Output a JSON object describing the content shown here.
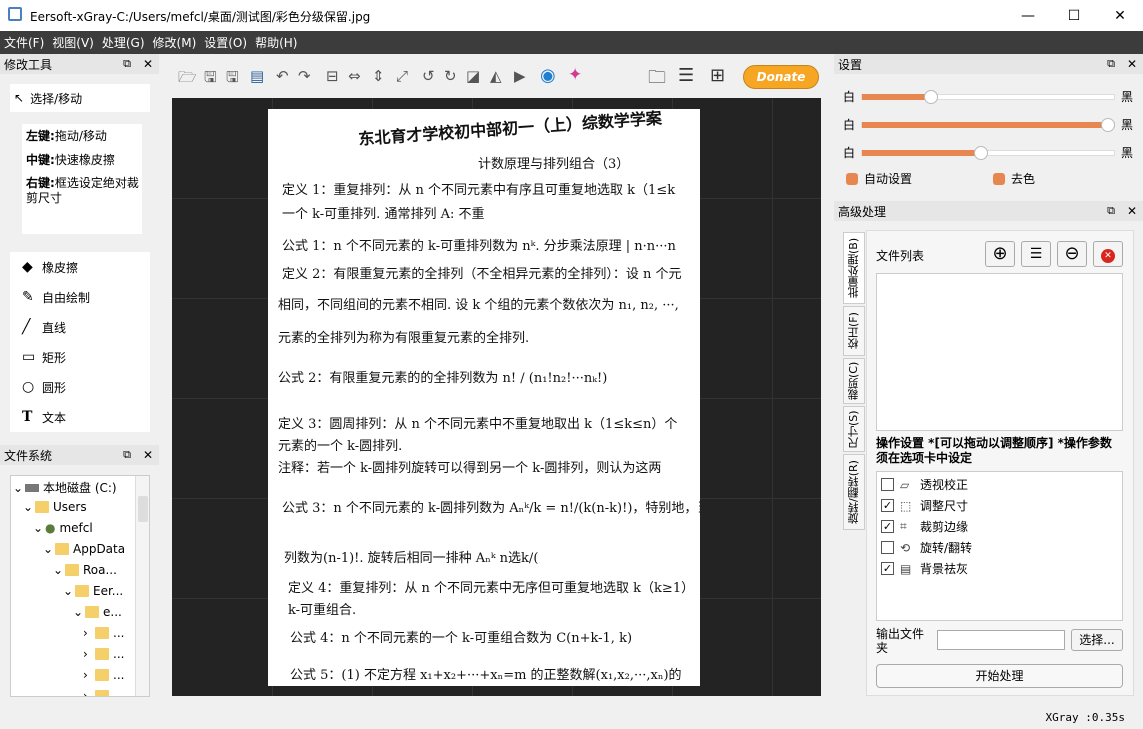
{
  "window": {
    "title": "Eersoft-xGray-C:/Users/mefcl/桌面/测试图/彩色分级保留.jpg",
    "minimize": "—",
    "maximize": "☐",
    "close": "✕"
  },
  "menu": [
    "文件(F)",
    "视图(V)",
    "处理(G)",
    "修改(M)",
    "设置(O)",
    "帮助(H)"
  ],
  "toolbar": {
    "donate": "Donate"
  },
  "tools_panel": {
    "title": "修改工具",
    "select": "选择/移动",
    "left_key": "左键:",
    "left_desc": "拖动/移动",
    "mid_key": "中键:",
    "mid_desc": "快速橡皮擦",
    "right_key": "右键:",
    "right_desc": "框选设定绝对裁剪尺寸",
    "items": [
      "橡皮擦",
      "自由绘制",
      "直线",
      "矩形",
      "圆形",
      "文本"
    ]
  },
  "fs_panel": {
    "title": "文件系统",
    "tree": [
      "本地磁盘 (C:)",
      "Users",
      "mefcl",
      "AppData",
      "Roa...",
      "Eer...",
      "e...",
      "...",
      "...",
      "...",
      "..."
    ]
  },
  "settings_panel": {
    "title": "设置",
    "white": "白",
    "black": "黑",
    "sliders": [
      0.27,
      0.97,
      0.47
    ],
    "auto_set": "自动设置",
    "decolor": "去色",
    "accent": "#e8864f"
  },
  "advanced_panel": {
    "title": "高级处理",
    "tabs": [
      "批量处理(B)",
      "校正(F)",
      "裁剪(C)",
      "尺寸(S)",
      "旋转/翻转(R)"
    ],
    "file_list": "文件列表",
    "op_title": "操作设置 *[可以拖动以调整顺序] *操作参数须在选项卡中设定",
    "ops": [
      {
        "label": "透视校正",
        "checked": false
      },
      {
        "label": "调整尺寸",
        "checked": true
      },
      {
        "label": "裁剪边缘",
        "checked": true
      },
      {
        "label": "旋转/翻转",
        "checked": false
      },
      {
        "label": "背景祛灰",
        "checked": true
      }
    ],
    "output_label": "输出文件夹",
    "choose": "选择...",
    "start": "开始处理"
  },
  "status": "XGray :0.35s",
  "document": {
    "lines": [
      "东北育才学校初中部初一（上）综数学学案",
      "计数原理与排列组合（3）",
      "定义 1：重复排列：从 n 个不同元素中有序且可重复地选取 k（1≤k",
      "一个 k-可重排列.   通常排列 A: 不重",
      "公式 1：n 个不同元素的 k-可重排列数为 nᵏ.  分步乘法原理 | n·n···n",
      "定义 2：有限重复元素的全排列（不全相异元素的全排列）：设 n 个元",
      "相同，不同组间的元素不相同. 设 k 个组的元素个数依次为 n₁, n₂, ···,",
      "元素的全排列为称为有限重复元素的全排列.",
      "公式 2：有限重复元素的的全排列数为  n! / (n₁!n₂!···nₖ!)",
      "定义 3：圆周排列：从 n 个不同元素中不重复地取出 k（1≤k≤n）个",
      "元素的一个 k-圆排列.",
      "注释：若一个 k-圆排列旋转可以得到另一个 k-圆排列，则认为这两",
      "公式 3：n 个不同元素的 k-圆排列数为 Aₙᵏ/k = n!/(k(n-k)!)，特别地，当",
      "列数为(n-1)!.       旋转后相同一排种        Aₙᵏ    n选k/(",
      "定义 4：重复排列：从 n 个不同元素中无序但可重复地选取 k（k≥1）",
      "k-可重组合.",
      "公式 4：n 个不同元素的一个 k-可重组合数为 C(n+k-1, k)",
      "公式 5：(1) 不定方程 x₁+x₂+···+xₙ=m 的正整数解(x₁,x₂,···,xₙ)的"
    ]
  }
}
